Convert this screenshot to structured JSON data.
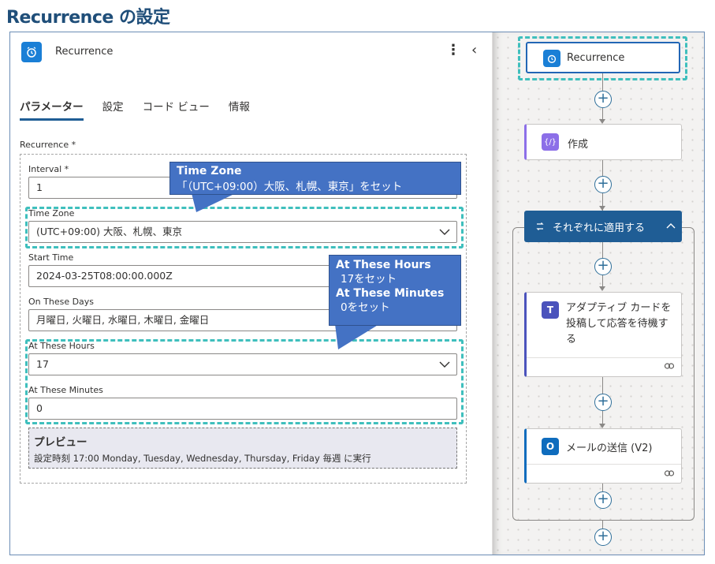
{
  "page_title": "Recurrence の設定",
  "panel": {
    "title": "Recurrence",
    "more_icon": "⋮",
    "collapse_icon": "‹",
    "tabs": [
      {
        "label": "パラメーター",
        "active": true
      },
      {
        "label": "設定",
        "active": false
      },
      {
        "label": "コード ビュー",
        "active": false
      },
      {
        "label": "情報",
        "active": false
      }
    ],
    "recurrence_label": "Recurrence *",
    "fields": {
      "interval": {
        "label": "Interval *",
        "value": "1"
      },
      "time_zone": {
        "label": "Time Zone",
        "value": "(UTC+09:00) 大阪、札幌、東京"
      },
      "start_time": {
        "label": "Start Time",
        "value": "2024-03-25T08:00:00.000Z"
      },
      "on_these_days": {
        "label": "On These Days",
        "value": "月曜日, 火曜日, 水曜日, 木曜日, 金曜日"
      },
      "at_these_hours": {
        "label": "At These Hours",
        "value": "17"
      },
      "at_these_minutes": {
        "label": "At These Minutes",
        "value": "0"
      }
    },
    "preview": {
      "title": "プレビュー",
      "text": "設定時刻 17:00 Monday, Tuesday, Wednesday, Thursday, Friday 毎週 に実行"
    }
  },
  "callouts": {
    "timezone": {
      "title": "Time Zone",
      "body": "「（UTC+09:00）大阪、札幌、東京」をセット"
    },
    "hours": {
      "title1": "At These Hours",
      "body1": "17をセット",
      "title2": "At These Minutes",
      "body2": "0をセット"
    }
  },
  "flow": {
    "recurrence": "Recurrence",
    "compose": "作成",
    "foreach": "それぞれに適用する",
    "adaptive_card": "アダプティブ カードを投稿して応答を待機する",
    "send_mail": "メールの送信 (V2)",
    "plus": "+"
  },
  "colors": {
    "title": "#1f4e79",
    "accent": "#1a7fd6",
    "highlight": "#3fbfbd",
    "callout": "#4472c4",
    "foreach_header": "#1f5d95",
    "compose_icon": "#8c6fe8",
    "teams": "#4b53bc",
    "outlook": "#0f6cbd"
  }
}
